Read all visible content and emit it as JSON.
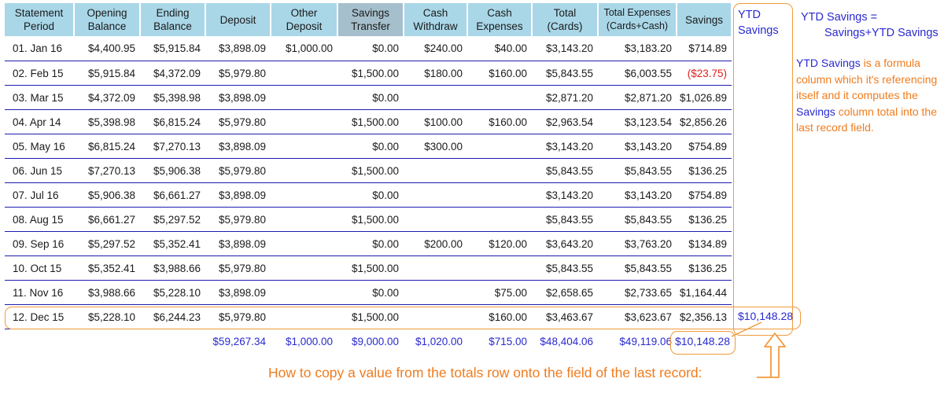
{
  "table": {
    "headers": [
      [
        "Statement",
        "Period"
      ],
      [
        "Opening",
        "Balance"
      ],
      [
        "Ending",
        "Balance"
      ],
      [
        "Deposit"
      ],
      [
        "Other",
        "Deposit"
      ],
      [
        "Savings",
        "Transfer"
      ],
      [
        "Cash",
        "Withdraw"
      ],
      [
        "Cash",
        "Expenses"
      ],
      [
        "Total",
        "(Cards)"
      ],
      [
        "Total Expenses",
        "(Cards+Cash)"
      ],
      [
        "Savings"
      ]
    ],
    "rows": [
      [
        "01. Jan 16",
        "$4,400.95",
        "$5,915.84",
        "$3,898.09",
        "$1,000.00",
        "$0.00",
        "$240.00",
        "$40.00",
        "$3,143.20",
        "$3,183.20",
        "$714.89"
      ],
      [
        "02. Feb 15",
        "$5,915.84",
        "$4,372.09",
        "$5,979.80",
        "",
        "$1,500.00",
        "$180.00",
        "$160.00",
        "$5,843.55",
        "$6,003.55",
        "($23.75)"
      ],
      [
        "03. Mar 15",
        "$4,372.09",
        "$5,398.98",
        "$3,898.09",
        "",
        "$0.00",
        "",
        "",
        "$2,871.20",
        "$2,871.20",
        "$1,026.89"
      ],
      [
        "04. Apr 14",
        "$5,398.98",
        "$6,815.24",
        "$5,979.80",
        "",
        "$1,500.00",
        "$100.00",
        "$160.00",
        "$2,963.54",
        "$3,123.54",
        "$2,856.26"
      ],
      [
        "05. May 16",
        "$6,815.24",
        "$7,270.13",
        "$3,898.09",
        "",
        "$0.00",
        "$300.00",
        "",
        "$3,143.20",
        "$3,143.20",
        "$754.89"
      ],
      [
        "06. Jun 15",
        "$7,270.13",
        "$5,906.38",
        "$5,979.80",
        "",
        "$1,500.00",
        "",
        "",
        "$5,843.55",
        "$5,843.55",
        "$136.25"
      ],
      [
        "07. Jul 16",
        "$5,906.38",
        "$6,661.27",
        "$3,898.09",
        "",
        "$0.00",
        "",
        "",
        "$3,143.20",
        "$3,143.20",
        "$754.89"
      ],
      [
        "08. Aug 15",
        "$6,661.27",
        "$5,297.52",
        "$5,979.80",
        "",
        "$1,500.00",
        "",
        "",
        "$5,843.55",
        "$5,843.55",
        "$136.25"
      ],
      [
        "09. Sep 16",
        "$5,297.52",
        "$5,352.41",
        "$3,898.09",
        "",
        "$0.00",
        "$200.00",
        "$120.00",
        "$3,643.20",
        "$3,763.20",
        "$134.89"
      ],
      [
        "10. Oct 15",
        "$5,352.41",
        "$3,988.66",
        "$5,979.80",
        "",
        "$1,500.00",
        "",
        "",
        "$5,843.55",
        "$5,843.55",
        "$136.25"
      ],
      [
        "11. Nov 16",
        "$3,988.66",
        "$5,228.10",
        "$3,898.09",
        "",
        "$0.00",
        "",
        "$75.00",
        "$2,658.65",
        "$2,733.65",
        "$1,164.44"
      ],
      [
        "12. Dec 15",
        "$5,228.10",
        "$6,244.23",
        "$5,979.80",
        "",
        "$1,500.00",
        "",
        "$160.00",
        "$3,463.67",
        "$3,623.67",
        "$2,356.13"
      ]
    ],
    "totals": [
      "",
      "",
      "",
      "$59,267.34",
      "$1,000.00",
      "$9,000.00",
      "$1,020.00",
      "$715.00",
      "$48,404.06",
      "$49,119.06",
      "$10,148.28"
    ]
  },
  "ytd_column": {
    "header_line1": "YTD",
    "header_line2": "Savings",
    "last_value": "$10,148.28"
  },
  "formula": {
    "line1": "YTD Savings =",
    "line2": "Savings+YTD Savings"
  },
  "note": {
    "term1": "YTD Savings",
    "text1": " is a formula column which it's referencing itself and it computes the ",
    "term2": "Savings",
    "text2": " column total into the last record field."
  },
  "instruction": "How to copy a value from the totals row onto the field of the last record:",
  "colors": {
    "header_bg": "#a9d7e8",
    "active_header_bg": "#a6bfcc",
    "row_line": "#1c1cae",
    "totals_text": "#2a2acf",
    "negative_text": "#e0201b",
    "annotation_orange": "#f07c1e"
  }
}
